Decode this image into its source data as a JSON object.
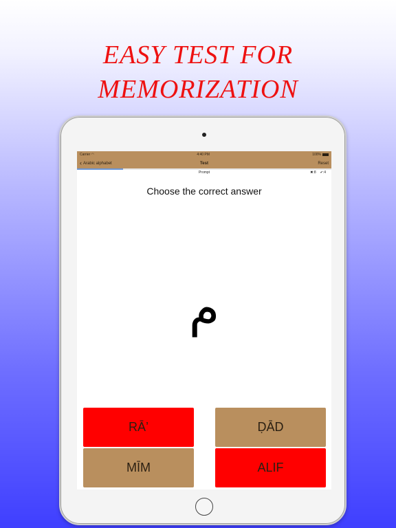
{
  "promo": {
    "line1": "EASY TEST FOR",
    "line2": "MEMORIZATION",
    "text_color": "#ee1111"
  },
  "status_bar": {
    "carrier": "Carrier",
    "wifi_icon": "wifi-icon",
    "time": "4:40 PM",
    "battery": "100%"
  },
  "nav": {
    "back_label": "Arabic alphabet",
    "title": "Test",
    "reset_label": "Reset",
    "bar_color": "#b98f5e"
  },
  "progress": {
    "fraction": 0.18
  },
  "prompt_row": {
    "label": "Prompt",
    "wrong": "✖:8",
    "correct": "✔:4"
  },
  "question": {
    "text": "Choose the correct answer",
    "letter": "م"
  },
  "answers": [
    {
      "label": "RĀ’",
      "color": "#ff0000"
    },
    {
      "label": "ḌĀD",
      "color": "#b98f5e"
    },
    {
      "label": "MĪM",
      "color": "#b98f5e"
    },
    {
      "label": "ALIF",
      "color": "#ff0000"
    }
  ]
}
